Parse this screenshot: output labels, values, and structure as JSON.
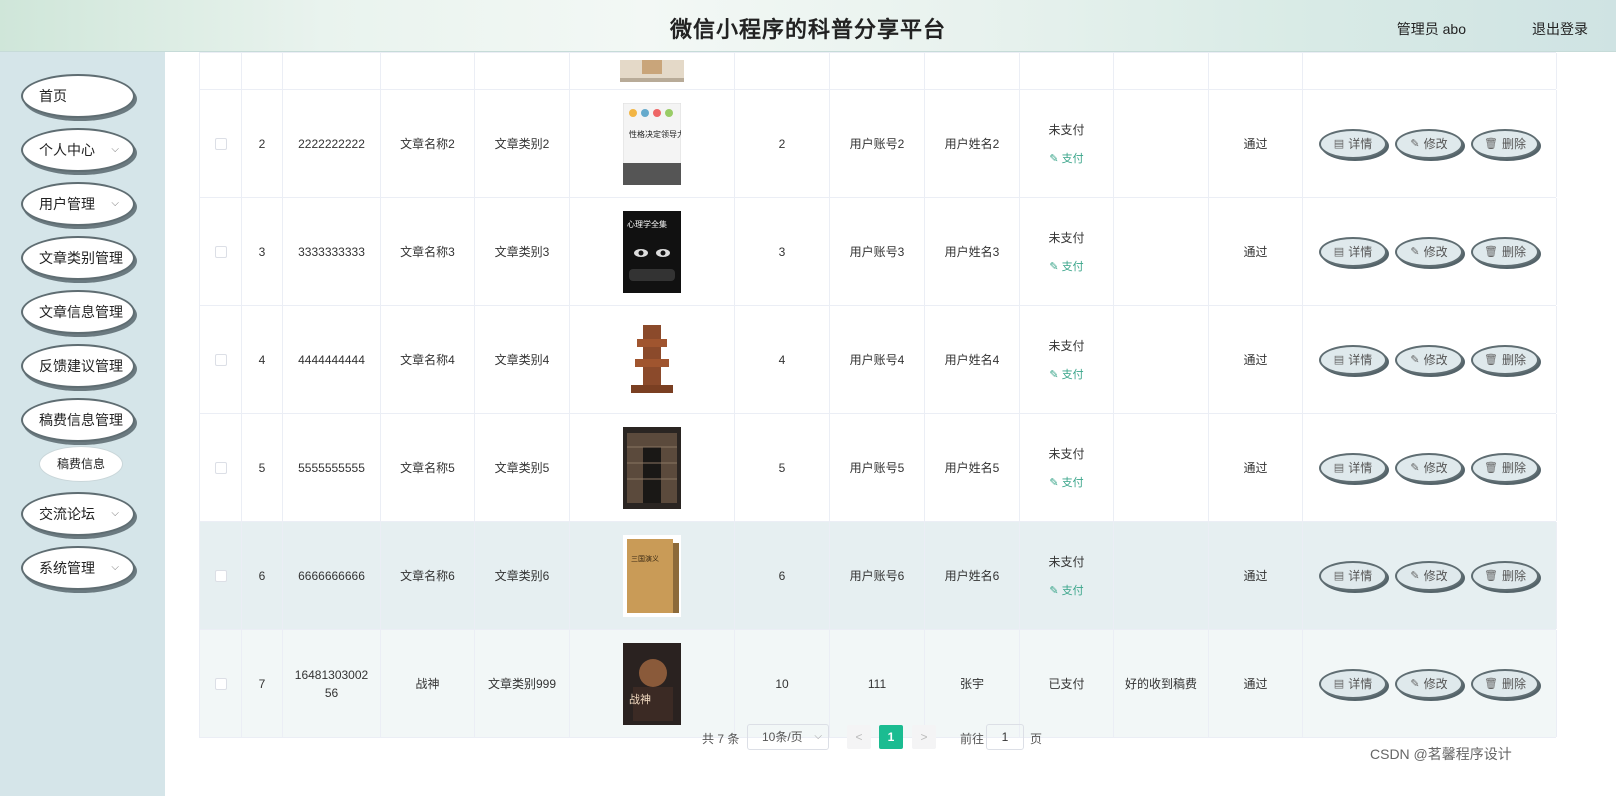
{
  "header": {
    "title": "微信小程序的科普分享平台",
    "admin": "管理员 abo",
    "logout": "退出登录"
  },
  "sidebar": {
    "items": [
      {
        "label": "首页",
        "chev": ""
      },
      {
        "label": "个人中心",
        "chev": "⌵"
      },
      {
        "label": "用户管理",
        "chev": "⌵"
      },
      {
        "label": "文章类别管理",
        "chev": ""
      },
      {
        "label": "文章信息管理",
        "chev": ""
      },
      {
        "label": "反馈建议管理",
        "chev": ""
      },
      {
        "label": "稿费信息管理",
        "chev": ""
      },
      {
        "label": "交流论坛",
        "chev": "⌵"
      },
      {
        "label": "系统管理",
        "chev": "⌵"
      }
    ],
    "sub_item": "稿费信息"
  },
  "table": {
    "rows": [
      {
        "idx": "2",
        "code": "2222222222",
        "name": "文章名称2",
        "category": "文章类别2",
        "qty": "2",
        "account": "用户账号2",
        "username": "用户姓名2",
        "status": "未支付",
        "pay": "支付",
        "remark": "",
        "audit": "通过"
      },
      {
        "idx": "3",
        "code": "3333333333",
        "name": "文章名称3",
        "category": "文章类别3",
        "qty": "3",
        "account": "用户账号3",
        "username": "用户姓名3",
        "status": "未支付",
        "pay": "支付",
        "remark": "",
        "audit": "通过"
      },
      {
        "idx": "4",
        "code": "4444444444",
        "name": "文章名称4",
        "category": "文章类别4",
        "qty": "4",
        "account": "用户账号4",
        "username": "用户姓名4",
        "status": "未支付",
        "pay": "支付",
        "remark": "",
        "audit": "通过"
      },
      {
        "idx": "5",
        "code": "5555555555",
        "name": "文章名称5",
        "category": "文章类别5",
        "qty": "5",
        "account": "用户账号5",
        "username": "用户姓名5",
        "status": "未支付",
        "pay": "支付",
        "remark": "",
        "audit": "通过"
      },
      {
        "idx": "6",
        "code": "6666666666",
        "name": "文章名称6",
        "category": "文章类别6",
        "qty": "6",
        "account": "用户账号6",
        "username": "用户姓名6",
        "status": "未支付",
        "pay": "支付",
        "remark": "",
        "audit": "通过"
      },
      {
        "idx": "7",
        "code": "1648130300256",
        "name": "战神",
        "category": "文章类别999",
        "qty": "10",
        "account": "111",
        "username": "张宇",
        "status": "已支付",
        "pay": "",
        "remark": "好的收到稿费",
        "audit": "通过"
      }
    ],
    "ops": {
      "detail": "详情",
      "edit": "修改",
      "delete": "删除"
    },
    "thumb_titles": [
      "性格决定领导力",
      "心理学全集",
      "",
      "",
      "三国演义",
      "战神"
    ]
  },
  "pager": {
    "total": "共 7 条",
    "size": "10条/页",
    "prev": "<",
    "page": "1",
    "next": ">",
    "goto": "前往",
    "goto_value": "1",
    "page_unit": "页"
  },
  "watermark": "CSDN @茗馨程序设计"
}
